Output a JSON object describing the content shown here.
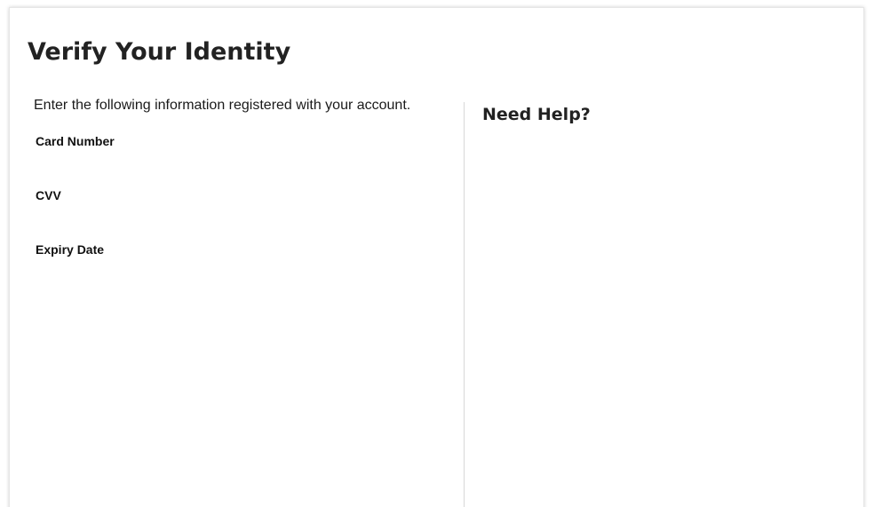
{
  "page": {
    "title": "Verify Your Identity"
  },
  "form": {
    "instructions": "Enter the following information registered with your account.",
    "fields": [
      {
        "label": "Card Number"
      },
      {
        "label": "CVV"
      },
      {
        "label": "Expiry Date"
      }
    ]
  },
  "help": {
    "title": "Need Help?"
  },
  "colors": {
    "background": "#ffffff",
    "card_border": "#e6e6e6",
    "divider": "#d8d8d8",
    "text": "#222222"
  }
}
